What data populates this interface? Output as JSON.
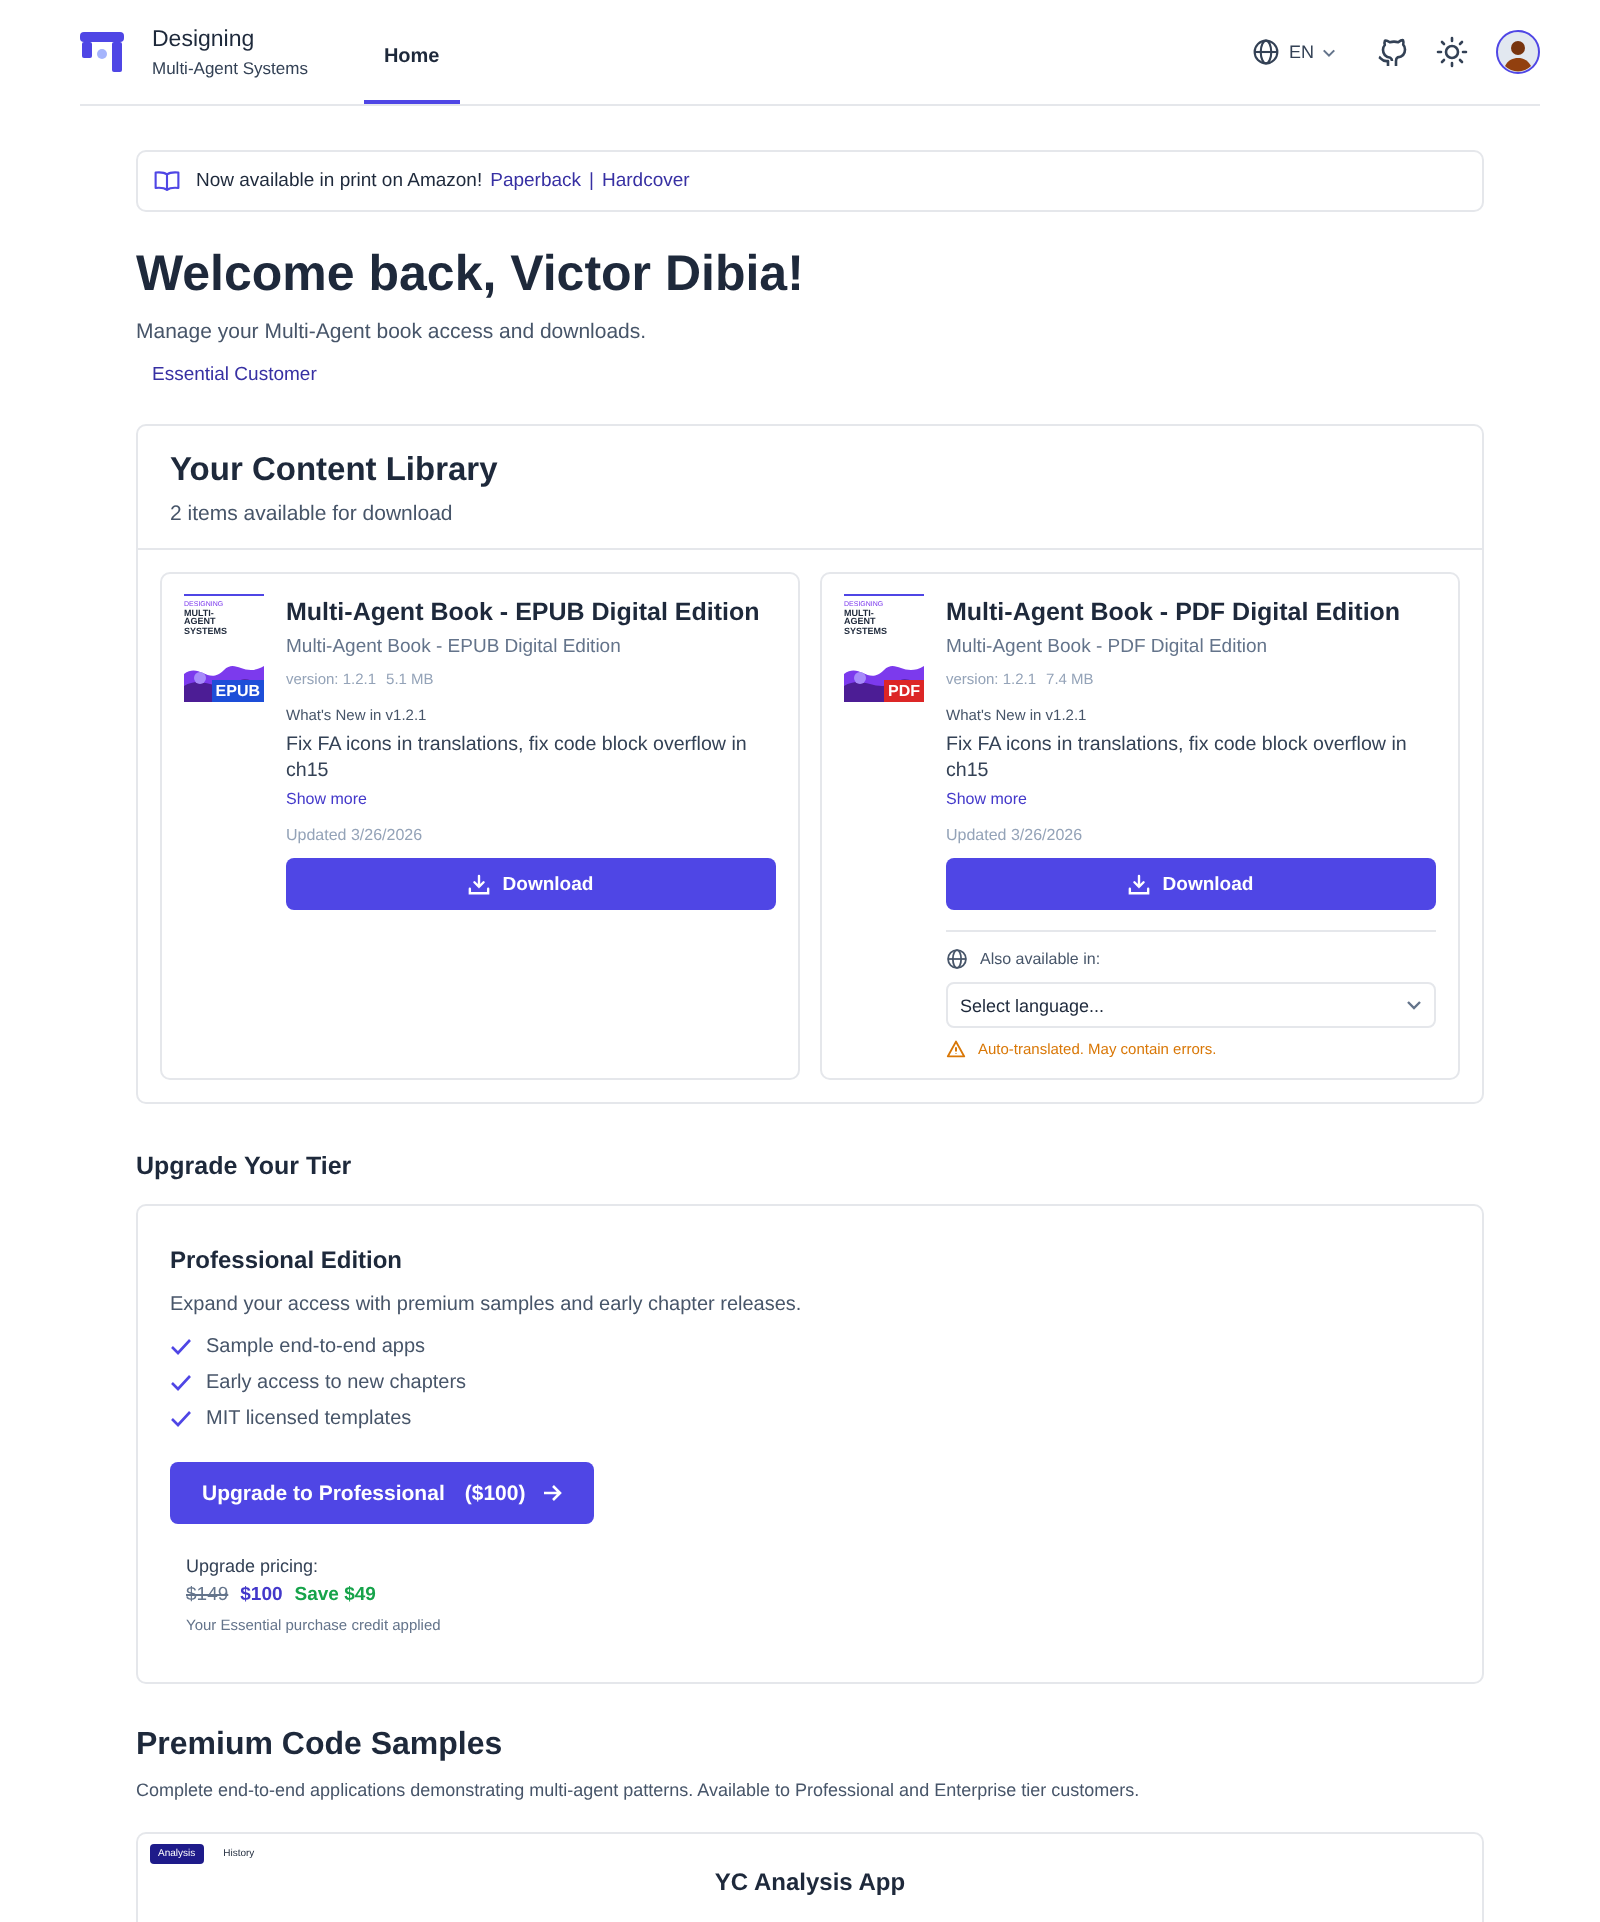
{
  "header": {
    "title": "Designing",
    "subtitle": "Multi-Agent Systems",
    "tabs": [
      {
        "label": "Home",
        "selected": true
      }
    ],
    "language": "EN"
  },
  "banner": {
    "text": "Now available in print on Amazon!",
    "links": [
      "Paperback",
      "Hardcover"
    ],
    "separator": "|"
  },
  "welcome": {
    "title": "Welcome back, Victor Dibia!",
    "subtitle": "Manage your Multi-Agent book access and downloads.",
    "badge": "Essential Customer"
  },
  "library": {
    "title": "Your Content Library",
    "count": "2 items available for download",
    "items": [
      {
        "title": "Multi-Agent Book - EPUB Digital Edition",
        "subtitle": "Multi-Agent Book - EPUB Digital Edition",
        "version": "version: 1.2.1",
        "size": "5.1 MB",
        "cover_line_1": "DESIGNING",
        "cover_line_2": "MULTI-AGENT SYSTEMS",
        "format": "EPUB",
        "color": "#1d4ed8",
        "whats_new_label": "What's New in v1.2.1",
        "whats_new": "Fix FA icons in translations, fix code block overflow in ch15",
        "show_more": "Show more",
        "updated": "Updated 3/26/2026",
        "button": "Download"
      },
      {
        "title": "Multi-Agent Book - PDF Digital Edition",
        "subtitle": "Multi-Agent Book - PDF Digital Edition",
        "version": "version: 1.2.1",
        "size": "7.4 MB",
        "cover_line_1": "DESIGNING",
        "cover_line_2": "MULTI-AGENT SYSTEMS",
        "format": "PDF",
        "color": "#dc2626",
        "whats_new_label": "What's New in v1.2.1",
        "whats_new": "Fix FA icons in translations, fix code block overflow in ch15",
        "show_more": "Show more",
        "updated": "Updated 3/26/2026",
        "button": "Download",
        "languages": {
          "label": "Also available in:",
          "placeholder": "Select language...",
          "warning": "Auto-translated. May contain errors."
        }
      }
    ]
  },
  "upgrade": {
    "title": "Upgrade Your Tier",
    "card": {
      "title": "Professional Edition",
      "description": "Expand your access with premium samples and early chapter releases.",
      "features": [
        "Sample end-to-end apps",
        "Early access to new chapters",
        "MIT licensed templates"
      ],
      "button": "Upgrade to Professional",
      "button_price": "($100)",
      "pricing_label": "Upgrade pricing:",
      "old_price": "$149",
      "new_price": "$100",
      "savings": "Save $49",
      "note": "Your Essential purchase credit applied"
    }
  },
  "samples": {
    "title": "Premium Code Samples",
    "description": "Complete end-to-end applications demonstrating multi-agent patterns. Available to Professional and Enterprise tier customers.",
    "preview": {
      "tabs": [
        {
          "label": "Analysis",
          "selected": true
        },
        {
          "label": "History",
          "selected": false
        }
      ],
      "title": "YC Analysis App"
    }
  }
}
